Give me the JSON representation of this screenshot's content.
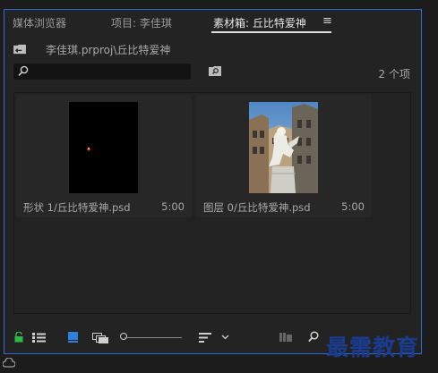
{
  "tabs": [
    {
      "label": "媒体浏览器",
      "active": false
    },
    {
      "label": "项目: 李佳琪",
      "active": false
    },
    {
      "label": "素材箱: 丘比特爱神",
      "active": true
    }
  ],
  "breadcrumb": {
    "path": "李佳琪.prproj\\丘比特爱神"
  },
  "search": {
    "placeholder": ""
  },
  "item_count": "2 个项",
  "items": [
    {
      "name": "形状 1/丘比特爱神.psd",
      "duration": "5:00",
      "thumbnail": "black-shape"
    },
    {
      "name": "图层 0/丘比特爱神.psd",
      "duration": "5:00",
      "thumbnail": "cupid-statue-photo"
    }
  ],
  "toolbar": {
    "icons": [
      "lock-icon",
      "list-view-icon",
      "icon-view-icon",
      "freeform-view-icon",
      "zoom-slider",
      "sort-icon",
      "chevron-down-icon",
      "automate-sequence-icon",
      "find-icon"
    ]
  },
  "watermark": {
    "text": "最需教育"
  },
  "colors": {
    "accent": "#2f6bd8",
    "lock": "#2fb84a",
    "view_active": "#2f7ee0",
    "watermark": "#1b3b8f"
  }
}
